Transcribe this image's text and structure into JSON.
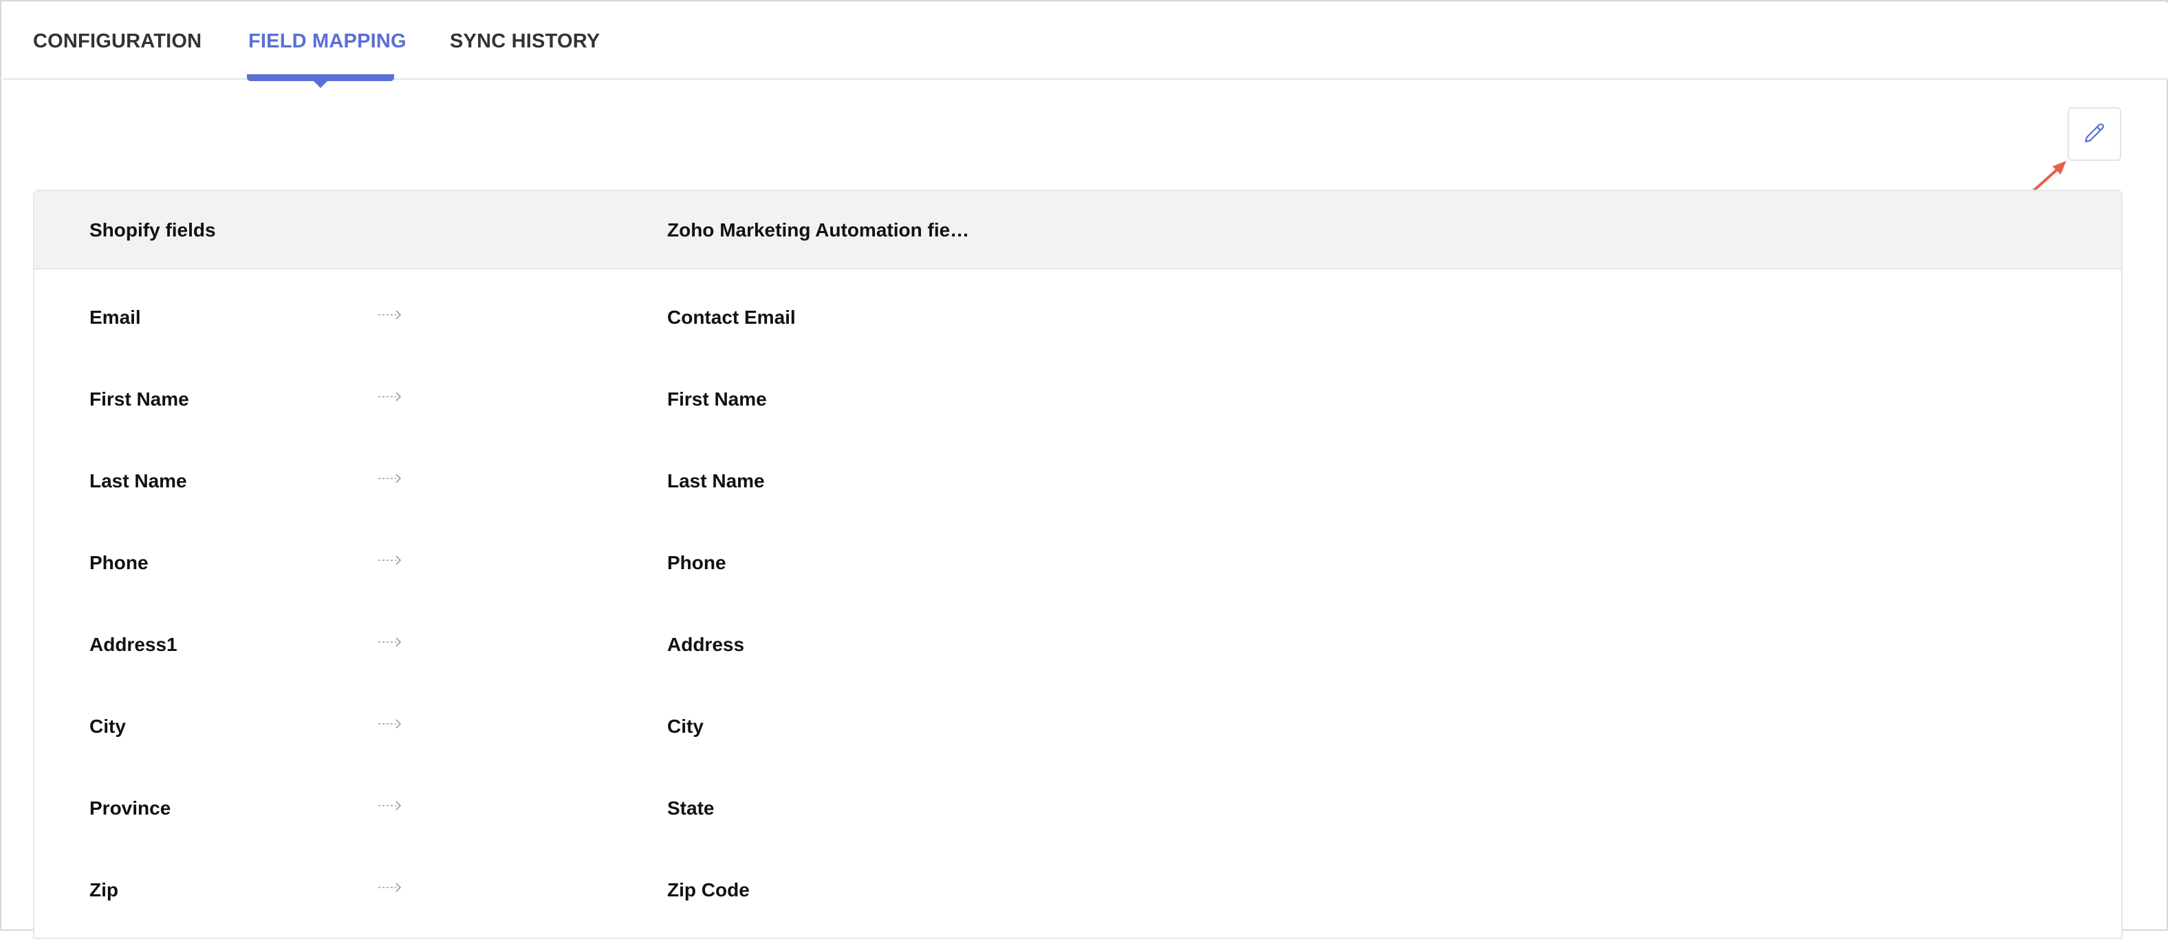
{
  "tabs": [
    {
      "label": "CONFIGURATION",
      "active": false
    },
    {
      "label": "FIELD MAPPING",
      "active": true
    },
    {
      "label": "SYNC HISTORY",
      "active": false
    }
  ],
  "toolbar": {
    "edit_icon": "pencil-icon"
  },
  "table": {
    "headers": {
      "source": "Shopify fields",
      "target": "Zoho Marketing Automation fie…"
    },
    "rows": [
      {
        "source": "Email",
        "target": "Contact Email"
      },
      {
        "source": "First Name",
        "target": "First Name"
      },
      {
        "source": "Last Name",
        "target": "Last Name"
      },
      {
        "source": "Phone",
        "target": "Phone"
      },
      {
        "source": "Address1",
        "target": "Address"
      },
      {
        "source": "City",
        "target": "City"
      },
      {
        "source": "Province",
        "target": "State"
      },
      {
        "source": "Zip",
        "target": "Zip Code"
      }
    ]
  },
  "colors": {
    "accent": "#5a6fd6",
    "annotation_arrow": "#e8604c",
    "header_bg": "#f2f2f2",
    "tab_text": "#333333"
  }
}
